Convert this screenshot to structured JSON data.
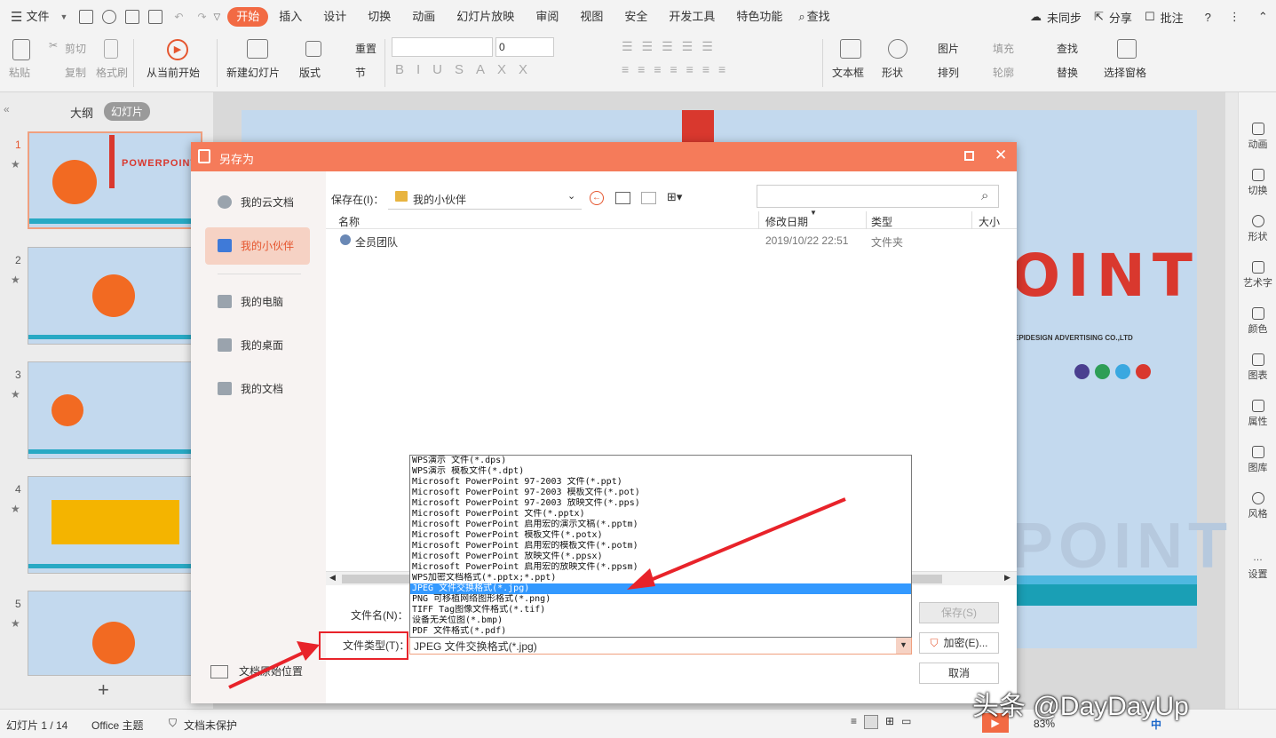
{
  "menubar": {
    "file": "文件",
    "tabs": [
      "开始",
      "插入",
      "设计",
      "切换",
      "动画",
      "幻灯片放映",
      "审阅",
      "视图",
      "安全",
      "开发工具",
      "特色功能"
    ],
    "search": "查找",
    "sync": "未同步",
    "share": "分享",
    "comment": "批注",
    "help": "?"
  },
  "ribbon": {
    "paste": "粘贴",
    "cut": "剪切",
    "copy": "复制",
    "format_painter": "格式刷",
    "from_current": "从当前开始",
    "new_slide": "新建幻灯片",
    "layout": "版式",
    "reset": "重置",
    "section": "节",
    "font_size": "0",
    "textbox": "文本框",
    "shape": "形状",
    "picture": "图片",
    "fill": "填充",
    "arrange": "排列",
    "outline": "轮廓",
    "find": "查找",
    "replace": "替换",
    "select_pane": "选择窗格"
  },
  "leftpanel": {
    "tab_outline": "大纲",
    "tab_slides": "幻灯片",
    "numbers": [
      "1",
      "2",
      "3",
      "4",
      "5"
    ],
    "slide1_title": "POWERPOINT"
  },
  "slide": {
    "big_text": "OINT",
    "company": "EPIDESIGN ADVERTISING CO.,LTD",
    "watermark": "POINT",
    "dots": [
      "#4a3f8f",
      "#2e9e56",
      "#3aa8e0",
      "#d9382e"
    ]
  },
  "rightbar": [
    "动画",
    "切换",
    "形状",
    "艺术字",
    "颜色",
    "图表",
    "属性",
    "图库",
    "风格",
    "设置"
  ],
  "status": {
    "slide_count": "幻灯片 1 / 14",
    "theme": "Office 主题",
    "protect": "文档未保护",
    "zoom": "83%",
    "ime": "中"
  },
  "dialog": {
    "title": "另存为",
    "nav": [
      "我的云文档",
      "我的小伙伴",
      "我的电脑",
      "我的桌面",
      "我的文档"
    ],
    "nav_bottom": "文档原始位置",
    "save_in_label": "保存在(I)：",
    "save_in_value": "我的小伙伴",
    "search_placeholder": "",
    "columns": [
      "名称",
      "修改日期",
      "类型",
      "大小"
    ],
    "files": [
      {
        "name": "全员团队",
        "date": "2019/10/22 22:51",
        "type": "文件夹"
      }
    ],
    "filename_label": "文件名(N)：",
    "filetype_label": "文件类型(T)：",
    "filetype_value": "JPEG 文件交换格式(*.jpg)",
    "save_btn": "保存(S)",
    "encrypt_btn": "加密(E)...",
    "cancel_btn": "取消",
    "filetype_options": [
      "WPS演示 文件(*.dps)",
      "WPS演示 模板文件(*.dpt)",
      "Microsoft PowerPoint 97-2003 文件(*.ppt)",
      "Microsoft PowerPoint 97-2003 模板文件(*.pot)",
      "Microsoft PowerPoint 97-2003 放映文件(*.pps)",
      "Microsoft PowerPoint 文件(*.pptx)",
      "Microsoft PowerPoint 启用宏的演示文稿(*.pptm)",
      "Microsoft PowerPoint 模板文件(*.potx)",
      "Microsoft PowerPoint 启用宏的模板文件(*.potm)",
      "Microsoft PowerPoint 放映文件(*.ppsx)",
      "Microsoft PowerPoint 启用宏的放映文件(*.ppsm)",
      "WPS加密文档格式(*.pptx;*.ppt)",
      "JPEG 文件交换格式(*.jpg)",
      "PNG 可移植网络图形格式(*.png)",
      "TIFF Tag图像文件格式(*.tif)",
      "设备无关位图(*.bmp)",
      "PDF 文件格式(*.pdf)"
    ],
    "selected_index": 12
  },
  "watermark_text": "头条 @DayDayUp"
}
